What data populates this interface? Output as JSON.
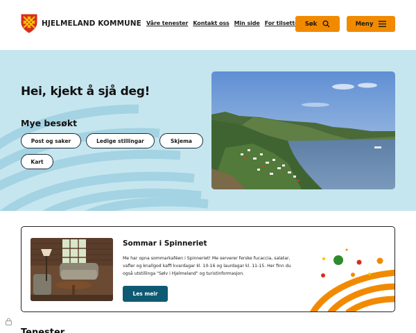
{
  "header": {
    "logo_text": "HJELMELAND KOMMUNE",
    "nav": [
      "Våre tenester",
      "Kontakt oss",
      "Min side",
      "For tilsette"
    ],
    "search_label": "Søk",
    "menu_label": "Meny"
  },
  "hero": {
    "title": "Hei, kjekt å sjå deg!",
    "subtitle": "Mye besøkt",
    "quick_links": [
      "Post og saker",
      "Ledige stillingar",
      "Skjema",
      "Kart"
    ]
  },
  "feature": {
    "title": "Sommar i Spinneriet",
    "body": "Me har opna sommarkaféen i Spinneriet! Me serverer ferske fucaccia, salatar, vafler og knallgod kaffi kvardagar kl. 10-16 og laurdagar kl. 11-15. Her finn du også utstillinga \"Sølv i Hjelmeland\" og turistinformasjon.",
    "button_label": "Les meir"
  },
  "next_section": {
    "title": "Tenester"
  },
  "colors": {
    "accent_orange": "#f28a00",
    "hero_bg": "#c6e6ef",
    "button_teal": "#0e5a73"
  },
  "icons": [
    "coat-of-arms-logo",
    "search-icon",
    "menu-icon",
    "lock-icon"
  ]
}
